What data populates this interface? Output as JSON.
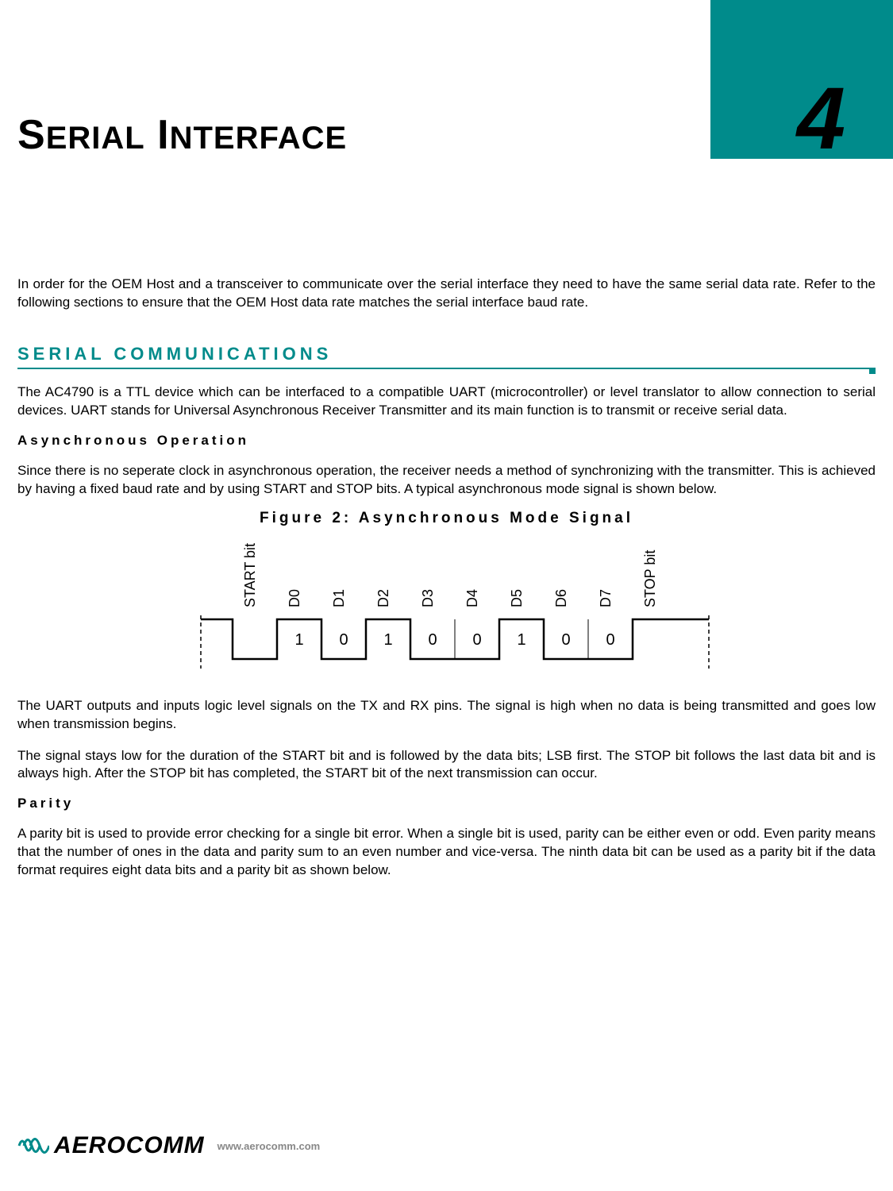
{
  "chapter": {
    "number": "4",
    "title_parts": [
      "S",
      "ERIAL",
      " I",
      "NTERFACE"
    ]
  },
  "intro": "In order for the OEM Host and a transceiver to communicate over the serial interface they need to have the same serial data rate.  Refer to the following sections to ensure that the OEM Host data rate matches the serial interface baud rate.",
  "section1": {
    "heading": "SERIAL COMMUNICATIONS",
    "para": "The AC4790 is a TTL device which can be interfaced to a compatible UART (microcontroller) or level translator to allow connection to serial devices.  UART stands for Universal Asynchronous Receiver Transmitter and its main function is to transmit or receive serial data."
  },
  "async": {
    "heading": "Asynchronous Operation",
    "para": "Since there is no seperate clock in asynchronous operation, the receiver needs a method of synchronizing with the transmitter.  This is achieved by having a fixed baud rate and by using START and STOP bits.  A typical asynchronous mode signal is shown below.",
    "figure_title": "Figure 2: Asynchronous Mode Signal"
  },
  "chart_data": {
    "type": "line",
    "title": "Asynchronous Mode Signal",
    "xlabel": "",
    "ylabel": "",
    "labels": [
      "START bit",
      "D0",
      "D1",
      "D2",
      "D3",
      "D4",
      "D5",
      "D6",
      "D7",
      "STOP bit"
    ],
    "values": [
      0,
      1,
      0,
      1,
      0,
      0,
      1,
      0,
      0,
      1
    ],
    "idle_level": 1,
    "idle_before": true,
    "idle_after": true
  },
  "after_chart": {
    "p1": "The UART outputs and inputs logic level signals on the TX and RX pins.  The signal is high when no data is being transmitted and goes low when transmission begins.",
    "p2": "The signal stays low for the duration of the START bit and is followed by the data bits; LSB first.  The STOP bit follows the last data bit and is always high.  After the STOP bit has completed, the START bit of the next transmission can occur."
  },
  "parity": {
    "heading": "Parity",
    "para": "A parity bit is used to provide error checking for a single bit error.  When a single bit is used, parity can be either even or odd.  Even parity means that the number of ones in the data and parity sum to an even number and vice-versa.  The ninth data bit can be used as a parity bit if the data format requires eight data bits and a parity bit as shown below."
  },
  "footer": {
    "brand": "AEROCOMM",
    "url": "www.aerocomm.com"
  }
}
